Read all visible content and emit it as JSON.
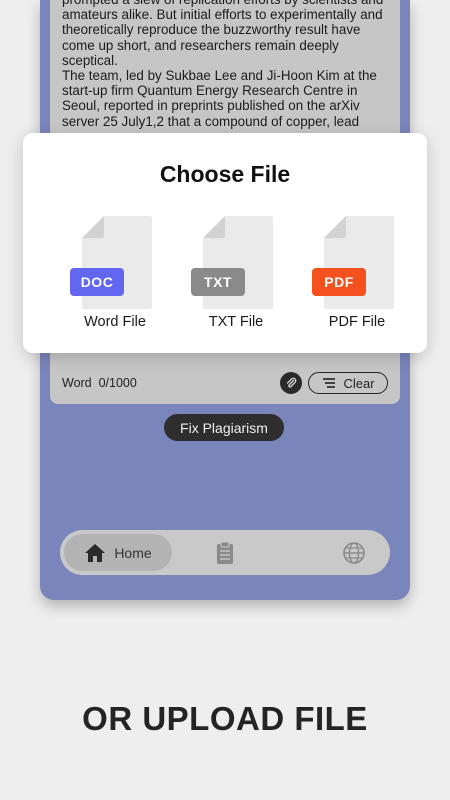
{
  "article": {
    "paragraphs": [
      "prompted a slew of replication efforts by scientists and amateurs alike. But initial efforts to experimentally and theoretically reproduce the buzzworthy result have come up short, and researchers remain deeply sceptical.",
      "The team, led by Sukbae Lee and Ji-Hoon Kim at the start-up firm Quantum Energy Research Centre in Seoul, reported in preprints published on the arXiv server 25 July1,2 that a compound of copper, lead"
    ]
  },
  "editor": {
    "word_label": "Word",
    "word_count": "0/1000",
    "clear_label": "Clear",
    "fix_label": "Fix Plagiarism"
  },
  "nav": {
    "home_label": "Home",
    "icons": [
      "home-icon",
      "clipboard-icon",
      "globe-icon"
    ]
  },
  "modal": {
    "title": "Choose File",
    "options": [
      {
        "badge": "DOC",
        "label": "Word File",
        "color": "#6366f1"
      },
      {
        "badge": "TXT",
        "label": "TXT File",
        "color": "#8a8a8a"
      },
      {
        "badge": "PDF",
        "label": "PDF File",
        "color": "#f4511e"
      }
    ]
  },
  "tagline": "OR UPLOAD FILE",
  "colors": {
    "phone_bg": "#7a85bb",
    "card_bg": "#c6c6c6",
    "page_bg": "#eeeeee"
  }
}
